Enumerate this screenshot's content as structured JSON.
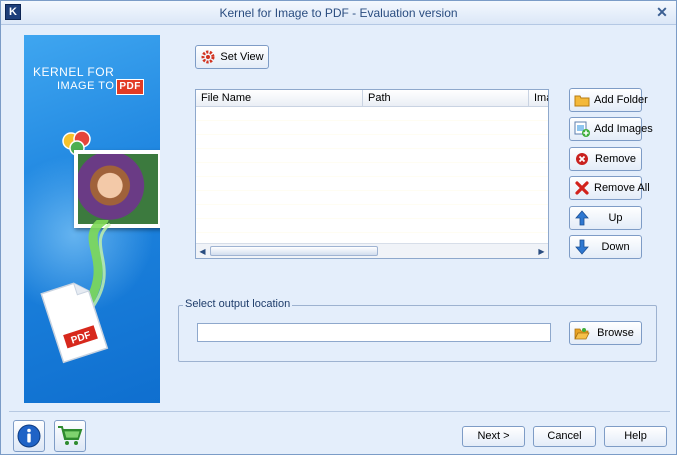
{
  "window": {
    "title": "Kernel for Image to PDF - Evaluation version",
    "app_icon_letter": "K",
    "close_glyph": "✕"
  },
  "banner": {
    "brand_line1": "KERNEL FOR",
    "brand_line2": "IMAGE TO",
    "brand_pdf": "PDF",
    "doc_label": "PDF"
  },
  "toolbar": {
    "set_view_label": "Set View"
  },
  "file_list": {
    "columns": [
      "File Name",
      "Path",
      "Ima"
    ],
    "rows": []
  },
  "side_buttons": {
    "add_folder": "Add Folder",
    "add_images": "Add Images",
    "remove": "Remove",
    "remove_all": "Remove All",
    "up": "Up",
    "down": "Down"
  },
  "output": {
    "legend": "Select output location",
    "path_value": "",
    "browse_label": "Browse"
  },
  "footer": {
    "next_label": "Next >",
    "cancel_label": "Cancel",
    "help_label": "Help"
  },
  "icons": {
    "info": "info-icon",
    "cart": "shopping-cart-icon"
  }
}
